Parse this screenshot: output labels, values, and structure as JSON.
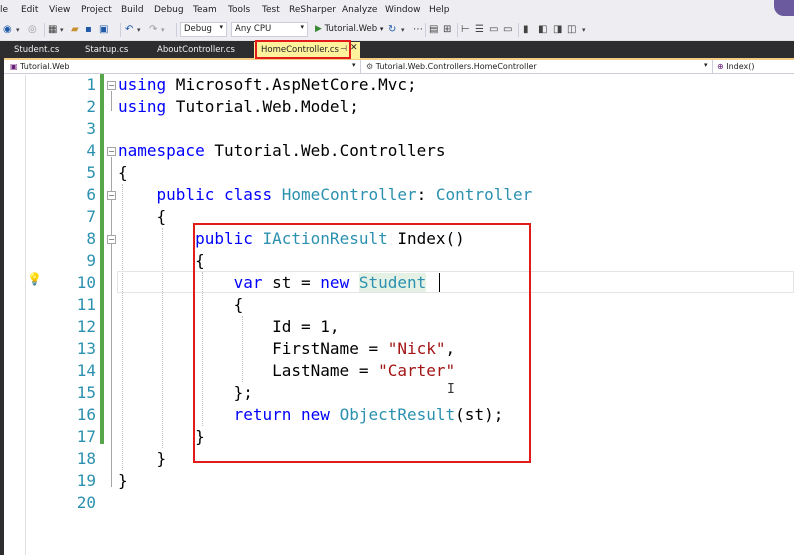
{
  "menu": [
    "le",
    "Edit",
    "View",
    "Project",
    "Build",
    "Debug",
    "Team",
    "Tools",
    "Test",
    "ReSharper",
    "Analyze",
    "Window",
    "Help"
  ],
  "toolbar": {
    "configuration": "Debug",
    "platform": "Any CPU",
    "start_label": "Tutorial.Web"
  },
  "tabs": [
    {
      "label": "Student.cs"
    },
    {
      "label": "Startup.cs"
    },
    {
      "label": "AboutController.cs"
    }
  ],
  "active_tab": {
    "label": "HomeController.cs",
    "pin": "⊣",
    "close": "✕"
  },
  "navbar": {
    "project": "Tutorial.Web",
    "class": "Tutorial.Web.Controllers.HomeController",
    "member": "Index()"
  },
  "line_numbers": [
    "1",
    "2",
    "3",
    "4",
    "5",
    "6",
    "7",
    "8",
    "9",
    "10",
    "11",
    "12",
    "13",
    "14",
    "15",
    "16",
    "17",
    "18",
    "19",
    "20"
  ],
  "code": {
    "l1_kw": "using",
    "l1_rest": " Microsoft.AspNetCore.Mvc;",
    "l2_kw": "using",
    "l2_rest": " Tutorial.Web.Model;",
    "l4_kw": "namespace",
    "l4_rest": " Tutorial.Web.Controllers",
    "l5": "{",
    "l6_indent": "    ",
    "l6_kw1": "public",
    "l6_sp1": " ",
    "l6_kw2": "class",
    "l6_sp2": " ",
    "l6_ty1": "HomeController",
    "l6_colon": ": ",
    "l6_ty2": "Controller",
    "l7": "    {",
    "l8_indent": "        ",
    "l8_kw": "public",
    "l8_sp": " ",
    "l8_ty": "IActionResult",
    "l8_rest": " Index()",
    "l9": "        {",
    "l10_indent": "            ",
    "l10_kw1": "var",
    "l10_mid": " st = ",
    "l10_kw2": "new",
    "l10_sp": " ",
    "l10_ty": "Student",
    "l11": "            {",
    "l12": "                Id = 1,",
    "l13_pre": "                FirstName = ",
    "l13_str": "\"Nick\"",
    "l13_post": ",",
    "l14_pre": "                LastName = ",
    "l14_str": "\"Carter\"",
    "l15": "            };",
    "l16_indent": "            ",
    "l16_kw1": "return",
    "l16_sp1": " ",
    "l16_kw2": "new",
    "l16_sp2": " ",
    "l16_ty": "ObjectResult",
    "l16_rest": "(st);",
    "l17": "        }",
    "l18": "    }",
    "l19": "}"
  },
  "colors": {
    "keyword": "#0000ff",
    "type": "#2b91af",
    "string": "#a31515",
    "line_number": "#2b91af",
    "change_marker": "#57a64a",
    "highlight_box": "#e21b1b",
    "active_tab": "#fff29d"
  },
  "icons": [
    "back-icon",
    "forward-icon",
    "new-project-icon",
    "open-icon",
    "save-icon",
    "save-all-icon",
    "undo-icon",
    "redo-icon",
    "start-debug-icon",
    "refresh-icon",
    "lightbulb-icon"
  ]
}
